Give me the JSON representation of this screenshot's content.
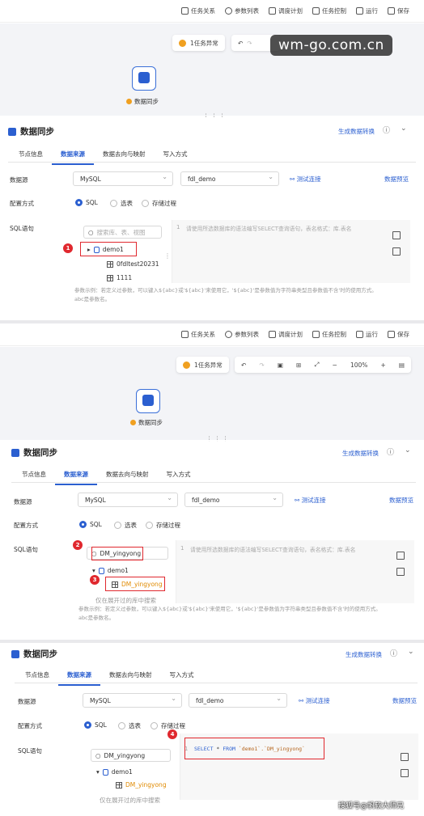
{
  "toolbar": {
    "items": [
      "任务关系",
      "参数列表",
      "调度计划",
      "任务控制",
      "运行",
      "保存"
    ]
  },
  "canvas": {
    "warning_1": "1任务异常",
    "warning_2": "1任务异常",
    "zoom": "100%",
    "node_label": "数据同步"
  },
  "panel": {
    "title": "数据同步",
    "generate_link": "生成数据转换",
    "tabs": [
      "节点信息",
      "数据来源",
      "数据去向与映射",
      "写入方式"
    ],
    "active_tab": "数据来源",
    "datasource_label": "数据源",
    "datasource_value": "MySQL",
    "connection_value": "fdl_demo",
    "test_link": "测试连接",
    "preview_link": "数据预览",
    "config_label": "配置方式",
    "config_options": [
      "SQL",
      "选表",
      "存储过程"
    ],
    "sql_label": "SQL语句",
    "search_placeholder": "搜索库、表、视图",
    "db_name": "demo1",
    "table_1": "0fdltest20231",
    "table_2": "1111",
    "editor_placeholder": "请使用所选数据库的语法编写SELECT查询语句，表名格式：库.表名",
    "hint_1a": "参数示例：若定义过参数，可以键入${abc}或'${abc}'来使用它，'${abc}'是参数值为字符串类型且参数值不含'时的使用方式。",
    "hint_1b": "abc是参数名。",
    "hint_2a": "参数示例：若定义过参数，可以键入${abc}或'${abc}'来使用它，'${abc}'是参数值为字符串类型且参数值不含'时的使用方式。",
    "hint_2b": "abc是参数名。",
    "search_value": "DM_yingyong",
    "search_value_3": "DM_yingyong",
    "found_table": "DM_yingyong",
    "found_table_3": "DM_yingyong",
    "search_note": "仅在展开过的库中搜索",
    "search_note_3": "仅在展开过的库中搜索",
    "line_1": "1",
    "line_2": "1",
    "line_3": "1",
    "sql_select": "SELECT",
    "sql_star": "*",
    "sql_from": "FROM",
    "sql_target": "`demo1`.`DM_yingyong`"
  },
  "steps": [
    "1",
    "2",
    "3",
    "4"
  ],
  "watermark": "wm-go.com.cn",
  "footer_watermark": "搜狐号@帆软大师兄",
  "colors": {
    "accent": "#2b5fd0",
    "highlight": "#e0282e",
    "warning": "#f0a020"
  }
}
